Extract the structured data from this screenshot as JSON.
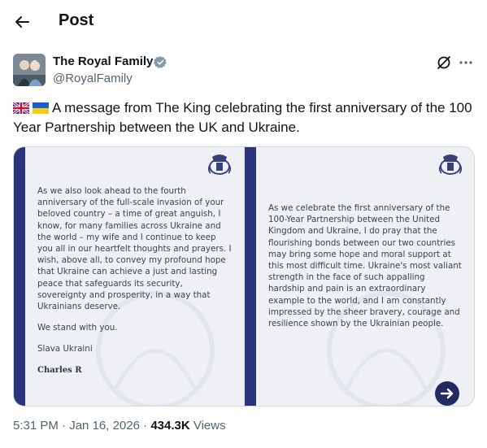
{
  "header": {
    "title": "Post",
    "back_icon": "arrow-left-icon"
  },
  "author": {
    "name": "The Royal Family",
    "handle": "@RoyalFamily",
    "verified_color": "#829aab"
  },
  "tweet": {
    "flags": [
      "uk-flag-icon",
      "ukraine-flag-icon"
    ],
    "text": "A message from The King celebrating the first anniversary of the 100 Year Partnership between the UK and Ukraine."
  },
  "media": {
    "left_letter": {
      "paragraph1": "As we also look ahead to the fourth anniversary of the full-scale invasion of your beloved country – a time of great anguish, I know, for many families across Ukraine and the world – my wife and I continue to keep you all in our heartfelt thoughts and prayers. I wish, above all, to convey my profound hope that Ukraine can achieve a just and lasting peace that safeguards its security, sovereignty and prosperity, in a way that Ukrainians deserve.",
      "paragraph2": "We stand with you.",
      "paragraph3": "Slava Ukraini",
      "signature": "Charles R"
    },
    "right_letter": {
      "paragraph1": "As we celebrate the first anniversary of the 100-Year Partnership between the United Kingdom and Ukraine, I do pray that the flourishing bonds between our two countries may bring some hope and moral support at this most difficult time. Ukraine's most valiant strength in the face of such appalling hardship and pain is an extraordinary example to the world, and I am constantly impressed by the sheer bravery, courage and resilience shown by the Ukrainian people."
    },
    "stripe_color": "#2a347c"
  },
  "meta": {
    "time": "5:31 PM",
    "separator": "·",
    "date": "Jan 16, 2026",
    "views_count": "434.3K",
    "views_label": "Views"
  }
}
